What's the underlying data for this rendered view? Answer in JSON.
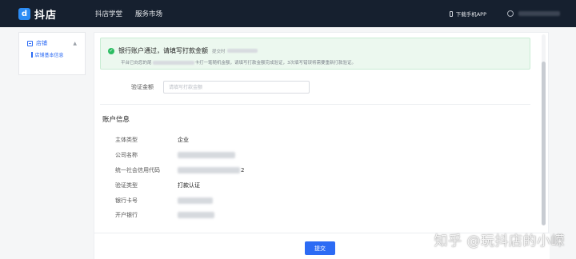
{
  "topbar": {
    "brand": "抖店",
    "brand_icon_glyph": "d",
    "nav": [
      "抖店学堂",
      "服务市场"
    ],
    "download_app": "下载手机APP"
  },
  "sidebar": {
    "section": "店铺",
    "items": [
      "店铺基本信息"
    ]
  },
  "alert": {
    "title": "银行账户通过，请填写打款金额",
    "submit_time_label": "提交时",
    "line_prefix": "平台已向您的尾",
    "line_suffix": "卡打一笔随机金额，请填写打款金额完成验证，3次填写错误将需要重新打款验证。"
  },
  "verify": {
    "label": "验证金额",
    "placeholder": "请填写打款金额"
  },
  "account": {
    "title": "账户信息",
    "rows": [
      {
        "label": "主体类型",
        "value": "企业"
      },
      {
        "label": "公司名称",
        "value": ""
      },
      {
        "label": "统一社会信用代码",
        "value": "",
        "tail": "2"
      },
      {
        "label": "验证类型",
        "value": "打款认证"
      },
      {
        "label": "银行卡号",
        "value": ""
      },
      {
        "label": "开户银行",
        "value": ""
      }
    ]
  },
  "footer": {
    "submit": "提交"
  },
  "watermark": "知乎 @玩抖店的小嵘",
  "colors": {
    "topbar": "#16202f",
    "primary": "#2c6bf4",
    "success": "#2cbd62",
    "alert_bg": "#ecf8ef"
  }
}
